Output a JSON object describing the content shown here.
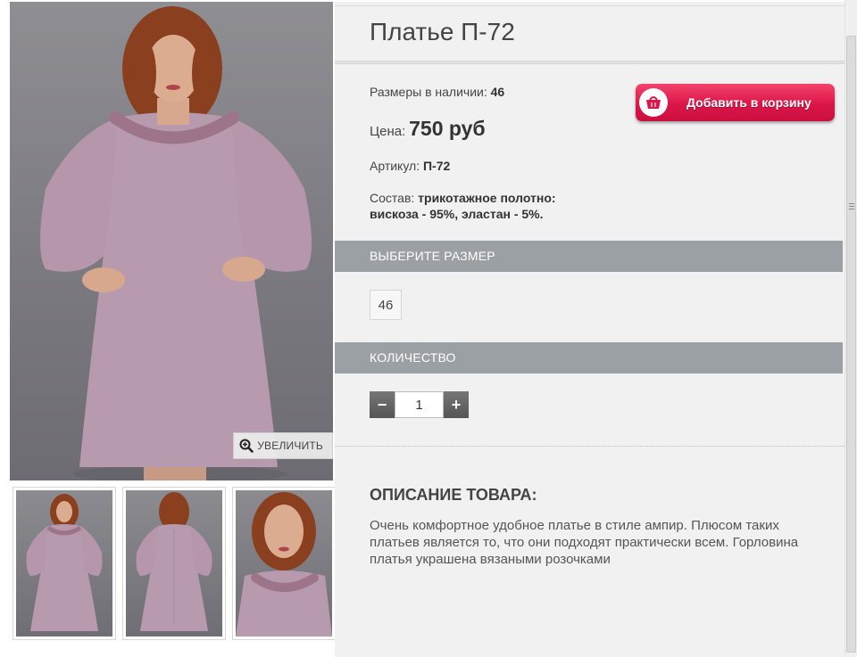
{
  "product": {
    "title": "Платье П-72",
    "sizes_label": "Размеры в наличии:",
    "sizes_value": "46",
    "price_label": "Цена:",
    "price_value": "750 руб",
    "sku_label": "Артикул:",
    "sku_value": "П-72",
    "composition_label": "Состав:",
    "composition_value": "трикотажное полотно: вискоза - 95%, эластан - 5%."
  },
  "cart_button": {
    "label": "Добавить в корзину",
    "icon": "basket-icon",
    "color": "#dd1549"
  },
  "gallery": {
    "zoom_label": "УВЕЛИЧИТЬ",
    "zoom_icon": "magnifier-plus-icon",
    "thumbnails": [
      "front-view",
      "back-view",
      "close-up"
    ]
  },
  "size_section": {
    "header": "ВЫБЕРИТЕ РАЗМЕР",
    "options": [
      "46"
    ]
  },
  "quantity_section": {
    "header": "КОЛИЧЕСТВО",
    "value": "1",
    "minus": "−",
    "plus": "+"
  },
  "description": {
    "heading": "ОПИСАНИЕ ТОВАРА:",
    "text": "Очень комфортное удобное платье в стиле ампир. Плюсом таких платьев является то, что они подходят практически всем. Горловина платья украшена вязаными розочками"
  },
  "colors": {
    "section_bar": "#9ba0a4",
    "panel_bg": "#f1f1f1",
    "dress": "#b89aae"
  }
}
